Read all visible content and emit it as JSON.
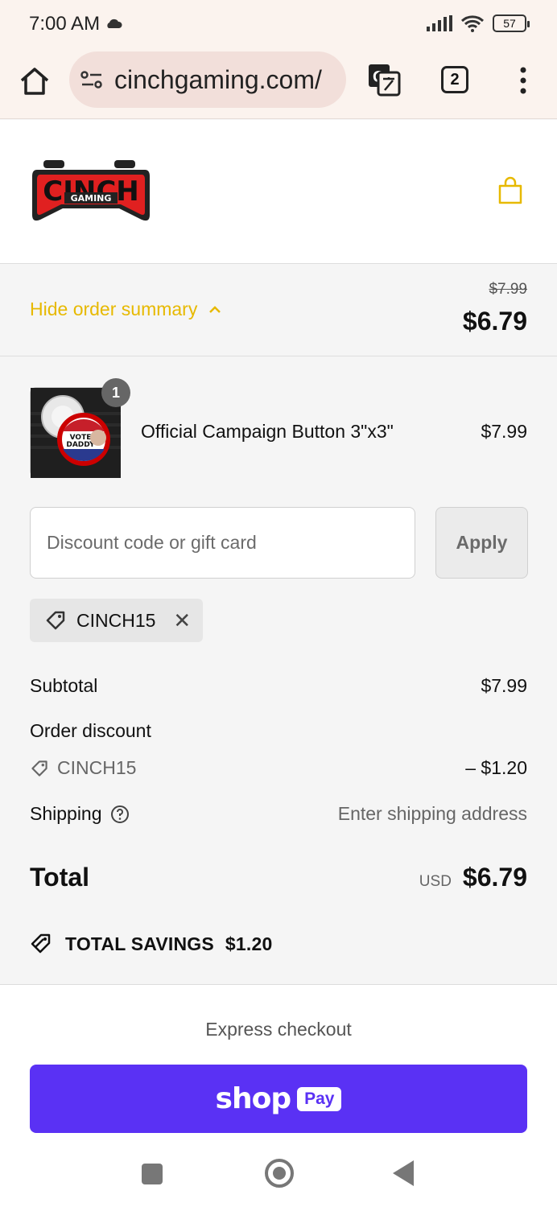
{
  "status_bar": {
    "time": "7:00 AM",
    "battery": "57"
  },
  "browser": {
    "url": "cinchgaming.com/",
    "tab_count": "2"
  },
  "store": {
    "logo_text": "CINCH",
    "logo_subtext": "GAMING"
  },
  "summary": {
    "toggle_label": "Hide order summary",
    "original_price": "$7.99",
    "price": "$6.79"
  },
  "item": {
    "quantity": "1",
    "name": "Official Campaign Button 3\"x3\"",
    "price": "$7.99",
    "thumb_text": "VOTE DADDY"
  },
  "discount": {
    "placeholder": "Discount code or gift card",
    "apply_label": "Apply",
    "applied_code": "CINCH15"
  },
  "totals": {
    "subtotal_label": "Subtotal",
    "subtotal_value": "$7.99",
    "order_discount_label": "Order discount",
    "discount_code": "CINCH15",
    "discount_value": "– $1.20",
    "shipping_label": "Shipping",
    "shipping_value": "Enter shipping address",
    "total_label": "Total",
    "currency": "USD",
    "total_value": "$6.79",
    "savings_label": "TOTAL SAVINGS",
    "savings_value": "$1.20"
  },
  "express": {
    "title": "Express checkout",
    "shop_word": "shop",
    "pay_word": "Pay"
  },
  "colors": {
    "accent": "#e7b900",
    "shop_pay": "#5a31f4",
    "logo_red": "#e02020"
  }
}
